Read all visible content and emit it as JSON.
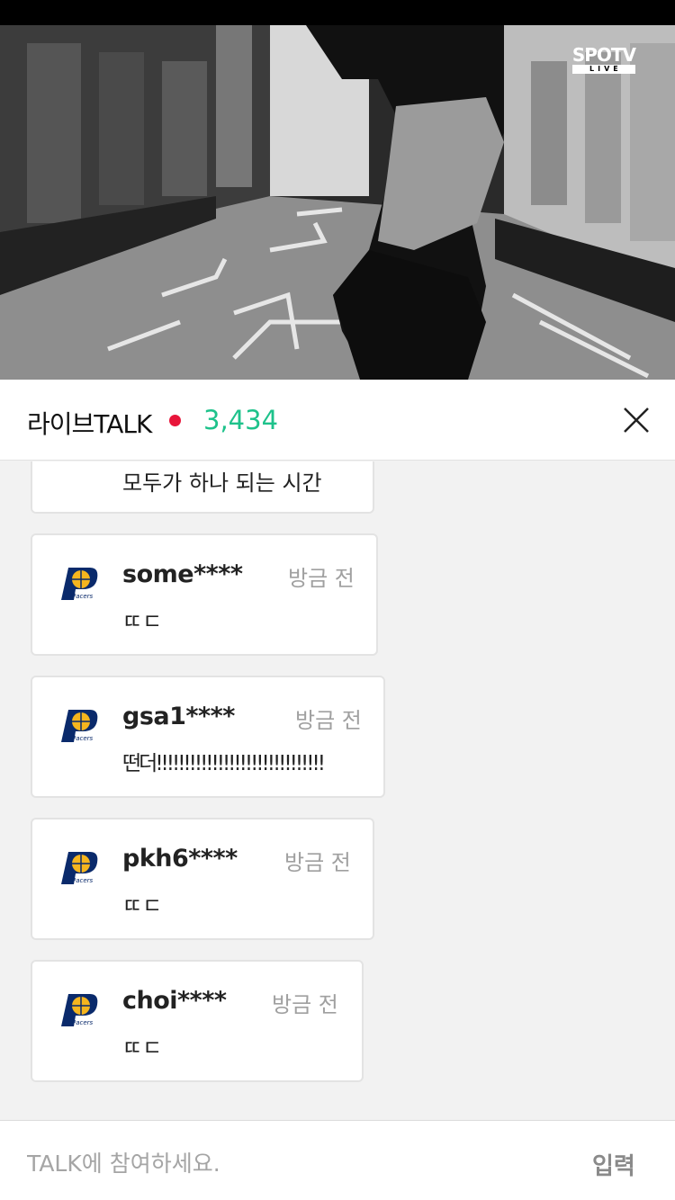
{
  "video": {
    "logo_main": "SPOTV",
    "logo_sub": "LIVE"
  },
  "header": {
    "title": "라이브TALK",
    "viewer_count": "3,434",
    "live_dot_color": "#e8153a",
    "count_color": "#1ec28b"
  },
  "messages": [
    {
      "username": "",
      "time": "",
      "text": "모두가 하나 되는 시간"
    },
    {
      "username": "some****",
      "time": "방금 전",
      "text": "ㄸㄷ",
      "team_logo": "pacers-logo"
    },
    {
      "username": "gsa1****",
      "time": "방금 전",
      "text": "떤더!!!!!!!!!!!!!!!!!!!!!!!!!!!!!!",
      "team_logo": "pacers-logo"
    },
    {
      "username": "pkh6****",
      "time": "방금 전",
      "text": "ㄸㄷ",
      "team_logo": "pacers-logo"
    },
    {
      "username": "choi****",
      "time": "방금 전",
      "text": "ㄸㄷ",
      "team_logo": "pacers-logo"
    }
  ],
  "footer": {
    "placeholder": "TALK에 참여하세요.",
    "submit_label": "입력"
  }
}
